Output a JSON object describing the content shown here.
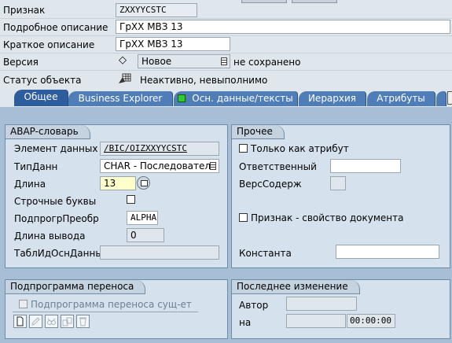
{
  "header": {
    "label_priznak": "Признак",
    "value_priznak": "ZXXYYCSTC",
    "label_podr": "Подробное описание",
    "value_podr": "ГрХХ МВЗ 13",
    "label_krat": "Краткое описание",
    "value_krat": "ГрХХ МВЗ 13",
    "label_version": "Версия",
    "version_symbol": "◇",
    "value_version": "Новое",
    "version_status": "не сохранено",
    "label_status": "Статус объекта",
    "status_text": "Неактивно, невыполнимо"
  },
  "tabs": [
    {
      "label": "Общее"
    },
    {
      "label": "Business Explorer"
    },
    {
      "label": "Осн. данные/тексты"
    },
    {
      "label": "Иерархия"
    },
    {
      "label": "Атрибуты"
    }
  ],
  "abap": {
    "title": "ABAP-словарь",
    "label_element": "Элемент данных",
    "value_element": "/BIC/OIZXXYYCSTC",
    "label_type": "ТипДанн",
    "value_type": "CHAR - Последователь",
    "label_length": "Длина",
    "value_length": "13",
    "label_lowercase": "Строчные буквы",
    "label_conv": "ПодпрогрПреобр",
    "value_conv": "ALPHA",
    "label_outlen": "Длина вывода",
    "value_outlen": "0",
    "label_mdtab": "ТаблИдОснДанных",
    "value_mdtab": ""
  },
  "misc": {
    "title": "Прочее",
    "attr_only": "Только как атрибут",
    "label_resp": "Ответственный",
    "value_resp": "",
    "label_content": "ВерсСодерж",
    "value_content": "",
    "doc_attr": "Признак - свойство документа",
    "label_const": "Константа",
    "value_const": ""
  },
  "transfer": {
    "title": "Подпрограмма переноса",
    "exists_label": "Подпрограмма переноса сущ-ет"
  },
  "lastchange": {
    "title": "Последнее изменение",
    "label_author": "Автор",
    "value_author": "",
    "label_on": "на",
    "value_date": "",
    "value_time": "00:00:00"
  }
}
